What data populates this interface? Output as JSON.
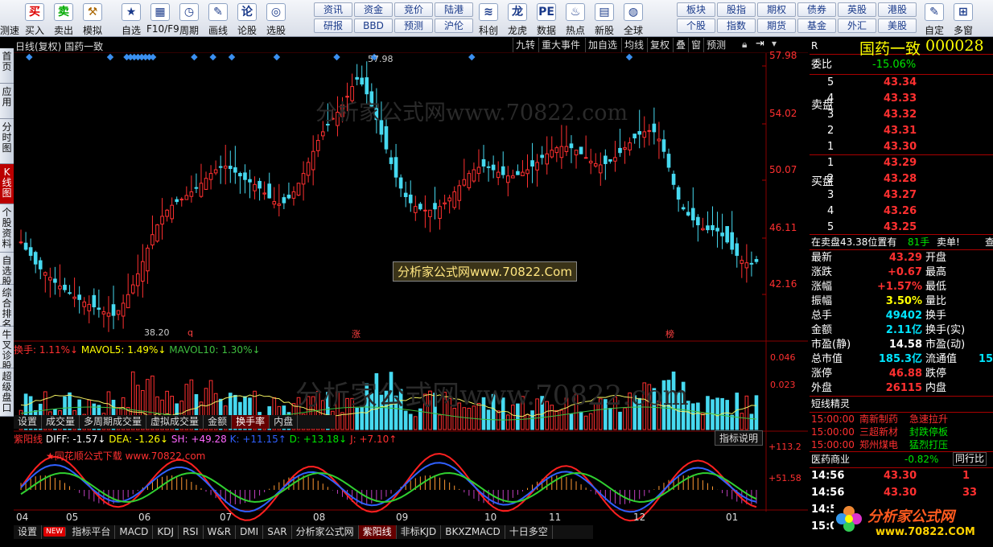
{
  "toolbar": {
    "trade": [
      {
        "icon": "买",
        "label": "买入",
        "color": "#d00"
      },
      {
        "icon": "卖",
        "label": "卖出",
        "color": "#0a0"
      },
      {
        "icon": "⚒",
        "label": "模拟",
        "color": "#a60"
      }
    ],
    "cut_label": "测速",
    "tools": [
      {
        "icon": "★",
        "label": "自选"
      },
      {
        "icon": "▦",
        "label": "F10/F9"
      },
      {
        "icon": "◷",
        "label": "周期"
      },
      {
        "icon": "✎",
        "label": "画线"
      },
      {
        "icon": "论",
        "label": "论股"
      },
      {
        "icon": "◎",
        "label": "选股"
      }
    ],
    "grid1": [
      [
        "资讯",
        "研报"
      ],
      [
        "资金",
        "BBD"
      ],
      [
        "竞价",
        "预测"
      ],
      [
        "陆港",
        "沪伦"
      ]
    ],
    "tools2": [
      {
        "icon": "≋",
        "label": "科创"
      },
      {
        "icon": "龙",
        "label": "龙虎"
      },
      {
        "icon": "PE",
        "label": "数据"
      },
      {
        "icon": "♨",
        "label": "热点"
      },
      {
        "icon": "▤",
        "label": "新股"
      },
      {
        "icon": "◍",
        "label": "全球"
      }
    ],
    "grid2": [
      [
        "板块",
        "个股"
      ],
      [
        "股指",
        "指数"
      ],
      [
        "期权",
        "期货"
      ],
      [
        "债券",
        "基金"
      ],
      [
        "英股",
        "外汇"
      ],
      [
        "港股",
        "美股"
      ]
    ],
    "tools3": [
      {
        "icon": "✎",
        "label": "自定"
      },
      {
        "icon": "⊞",
        "label": "多窗"
      }
    ]
  },
  "side_tabs": [
    "首页",
    "应用",
    "分时图",
    "K线图",
    "个股资料",
    "自选股",
    "综合排名",
    "牛叉诊股",
    "超级盘口"
  ],
  "chart_header": {
    "left": "日线(复权)  国药一致",
    "buttons": [
      "九转",
      "重大事件",
      "加自选",
      "均线",
      "复权",
      "叠",
      "窗",
      "预测"
    ]
  },
  "price_axis": [
    "57.98",
    "54.02",
    "50.07",
    "46.11",
    "42.16"
  ],
  "annotations": {
    "high": "57.98",
    "low": "38.20",
    "q": "q",
    "zhang": "涨",
    "bang": "榜"
  },
  "watermark_top": "分析家公式网www.70822.com",
  "watermark_box": "分析家公式网www.70822.Com",
  "vol_legend": {
    "a": "换手: 1.11%↓",
    "b": "MAVOL5: 1.49%↓",
    "c": "MAVOL10: 1.30%↓"
  },
  "vol_axis": [
    "0.046",
    "0.023"
  ],
  "vol_tabs": [
    "设置",
    "成交量",
    "多周期成交量",
    "虚拟成交量",
    "金额",
    "换手率",
    "内盘"
  ],
  "ind_legend": {
    "name": "紫阳线",
    "diff": "DIFF: -1.57↓",
    "dea": "DEA: -1.26↓",
    "sh": "SH: +49.28",
    "k": "K: +11.15↑",
    "d": "D: +13.18↓",
    "j": "J: +7.10↑"
  },
  "ind_help": "指标说明",
  "ind_axis": [
    "+113.2",
    "+51.58"
  ],
  "ind_watermark": "★同花顺公式下载  www.70822.com",
  "months": [
    "04",
    "05",
    "06",
    "07",
    "08",
    "09",
    "10",
    "11",
    "12",
    "01"
  ],
  "bottom_tabs": [
    "设置",
    "NEW",
    "指标平台",
    "MACD",
    "KDJ",
    "RSI",
    "W&R",
    "DMI",
    "SAR",
    "分析家公式网",
    "紫阳线",
    "非标KJD",
    "BKXZMACD",
    "十日多空"
  ],
  "quote": {
    "tag": "R",
    "name": "国药一致",
    "code": "000028",
    "weibi_label": "委比",
    "weibi": "-15.06%",
    "sell_label": "卖盘",
    "buy_label": "买盘",
    "sells": [
      [
        "5",
        "43.34"
      ],
      [
        "4",
        "43.33"
      ],
      [
        "3",
        "43.32"
      ],
      [
        "2",
        "43.31"
      ],
      [
        "1",
        "43.30"
      ]
    ],
    "buys": [
      [
        "1",
        "43.29"
      ],
      [
        "2",
        "43.28"
      ],
      [
        "3",
        "43.27"
      ],
      [
        "4",
        "43.26"
      ],
      [
        "5",
        "43.25"
      ]
    ],
    "ticker_a": "在卖盘43.38位置有",
    "ticker_b": "81手",
    "ticker_c": "卖单!",
    "ticker_d": "查",
    "stats": [
      {
        "l": "最新",
        "v": "43.29",
        "c": "red",
        "r": "开盘",
        "rv": ""
      },
      {
        "l": "涨跌",
        "v": "+0.67",
        "c": "red",
        "r": "最高",
        "rv": ""
      },
      {
        "l": "涨幅",
        "v": "+1.57%",
        "c": "red",
        "r": "最低",
        "rv": ""
      },
      {
        "l": "振幅",
        "v": "3.50%",
        "c": "yel",
        "r": "量比",
        "rv": ""
      },
      {
        "l": "总手",
        "v": "49402",
        "c": "cy",
        "r": "换手",
        "rv": ""
      },
      {
        "l": "金额",
        "v": "2.11亿",
        "c": "cy",
        "r": "换手(实)",
        "rv": ""
      },
      {
        "l": "市盈(静)",
        "v": "14.58",
        "c": "wh",
        "r": "市盈(动)",
        "rv": ""
      },
      {
        "l": "总市值",
        "v": "185.3亿",
        "c": "cy",
        "r": "流通值",
        "rv": "15"
      },
      {
        "l": "涨停",
        "v": "46.88",
        "c": "red",
        "r": "跌停",
        "rv": ""
      },
      {
        "l": "外盘",
        "v": "26115",
        "c": "red",
        "r": "内盘",
        "rv": ""
      }
    ],
    "news_title": "短线精灵",
    "news": [
      {
        "t": "15:00:00",
        "s": "南新制药",
        "e": "急速拉升",
        "c": "red"
      },
      {
        "t": "15:00:00",
        "s": "三超新材",
        "e": "封跌停板",
        "c": "grn"
      },
      {
        "t": "15:00:00",
        "s": "郑州煤电",
        "e": "猛烈打压",
        "c": "grn"
      }
    ],
    "sector": {
      "name": "医药商业",
      "chg": "-0.82%",
      "btn": "同行比"
    },
    "ticks": [
      {
        "t": "14:56",
        "p": "43.30",
        "v": "1"
      },
      {
        "t": "14:56",
        "p": "43.30",
        "v": "33"
      },
      {
        "t": "14:5",
        "p": "",
        "v": ""
      },
      {
        "t": "15:0",
        "p": "",
        "v": ""
      }
    ],
    "logo_text": "分析家公式网",
    "logo_url": "www.70822.COM"
  },
  "chart_data": {
    "type": "candlestick",
    "title": "国药一致 日线(复权)",
    "ylim": [
      36.5,
      59.5
    ],
    "months": [
      "04",
      "05",
      "06",
      "07",
      "08",
      "09",
      "10",
      "11",
      "12",
      "01"
    ],
    "close": [
      44.2,
      43.6,
      43.1,
      42.4,
      42.0,
      41.7,
      41.3,
      40.9,
      40.6,
      40.3,
      40.0,
      39.7,
      39.5,
      39.3,
      39.1,
      38.9,
      38.7,
      38.5,
      38.4,
      38.2,
      38.6,
      39.2,
      39.9,
      40.7,
      41.6,
      42.6,
      43.7,
      44.8,
      45.6,
      46.3,
      46.8,
      47.2,
      47.5,
      47.7,
      48.0,
      48.3,
      48.6,
      49.0,
      49.4,
      49.8,
      50.1,
      50.3,
      50.4,
      50.2,
      49.9,
      49.6,
      49.3,
      49.1,
      48.9,
      48.6,
      48.2,
      47.8,
      47.5,
      47.3,
      47.4,
      47.8,
      48.3,
      49.0,
      49.8,
      50.7,
      51.6,
      52.5,
      53.2,
      53.8,
      54.3,
      54.8,
      55.4,
      56.1,
      56.9,
      57.5,
      57.1,
      56.3,
      55.3,
      54.2,
      53.0,
      51.8,
      50.6,
      49.5,
      48.6,
      47.9,
      47.4,
      47.1,
      46.9,
      46.8,
      46.8,
      46.9,
      47.1,
      47.4,
      47.8,
      48.3,
      48.8,
      49.3,
      49.8,
      50.1,
      50.3,
      50.4,
      50.3,
      50.1,
      49.9,
      49.7,
      49.6,
      49.6,
      49.7,
      49.9,
      50.1,
      50.4,
      50.7,
      51.1,
      51.4,
      51.7,
      51.9,
      52.0,
      52.0,
      51.9,
      51.7,
      51.4,
      51.1,
      50.8,
      50.6,
      50.5,
      50.6,
      50.8,
      51.1,
      51.5,
      51.9,
      52.3,
      52.7,
      53.0,
      53.2,
      53.3,
      53.2,
      52.6,
      51.6,
      50.3,
      48.9,
      47.7,
      46.9,
      46.4,
      46.0,
      45.6,
      45.3,
      45.2,
      45.2,
      45.1,
      44.7,
      44.2,
      43.6,
      43.1,
      42.7,
      42.5,
      42.4,
      42.6
    ]
  }
}
